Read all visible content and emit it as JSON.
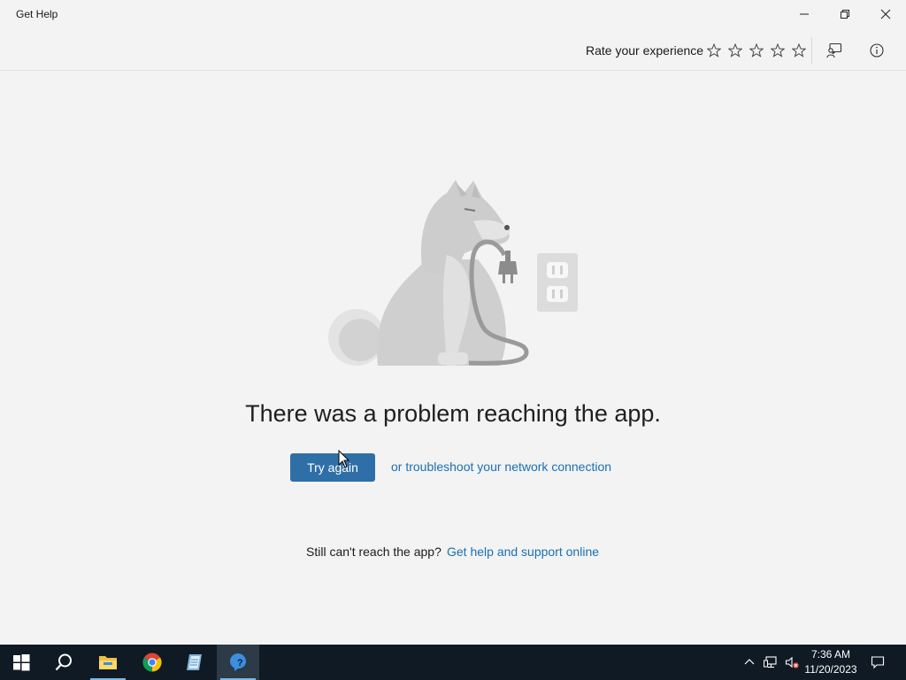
{
  "window": {
    "title": "Get Help"
  },
  "command_bar": {
    "rate_label": "Rate your experience",
    "stars_total": 5,
    "stars_filled": 0
  },
  "main": {
    "headline": "There was a problem reaching the app.",
    "try_again_label": "Try again",
    "troubleshoot_link": "or troubleshoot your network connection",
    "still_text": "Still can't reach the app?",
    "support_link": "Get help and support online"
  },
  "taskbar": {
    "items": [
      {
        "icon": "windows-start-icon"
      },
      {
        "icon": "search-icon"
      },
      {
        "icon": "file-explorer-icon"
      },
      {
        "icon": "chrome-icon"
      },
      {
        "icon": "notepad-app-icon"
      },
      {
        "icon": "get-help-icon",
        "active": true
      }
    ],
    "clock": {
      "time": "7:36 AM",
      "date": "11/20/2023"
    }
  },
  "colors": {
    "accent_button": "#2f6fa8",
    "link": "#1a6fb3",
    "taskbar": "#101a24",
    "background": "#f3f3f3"
  }
}
